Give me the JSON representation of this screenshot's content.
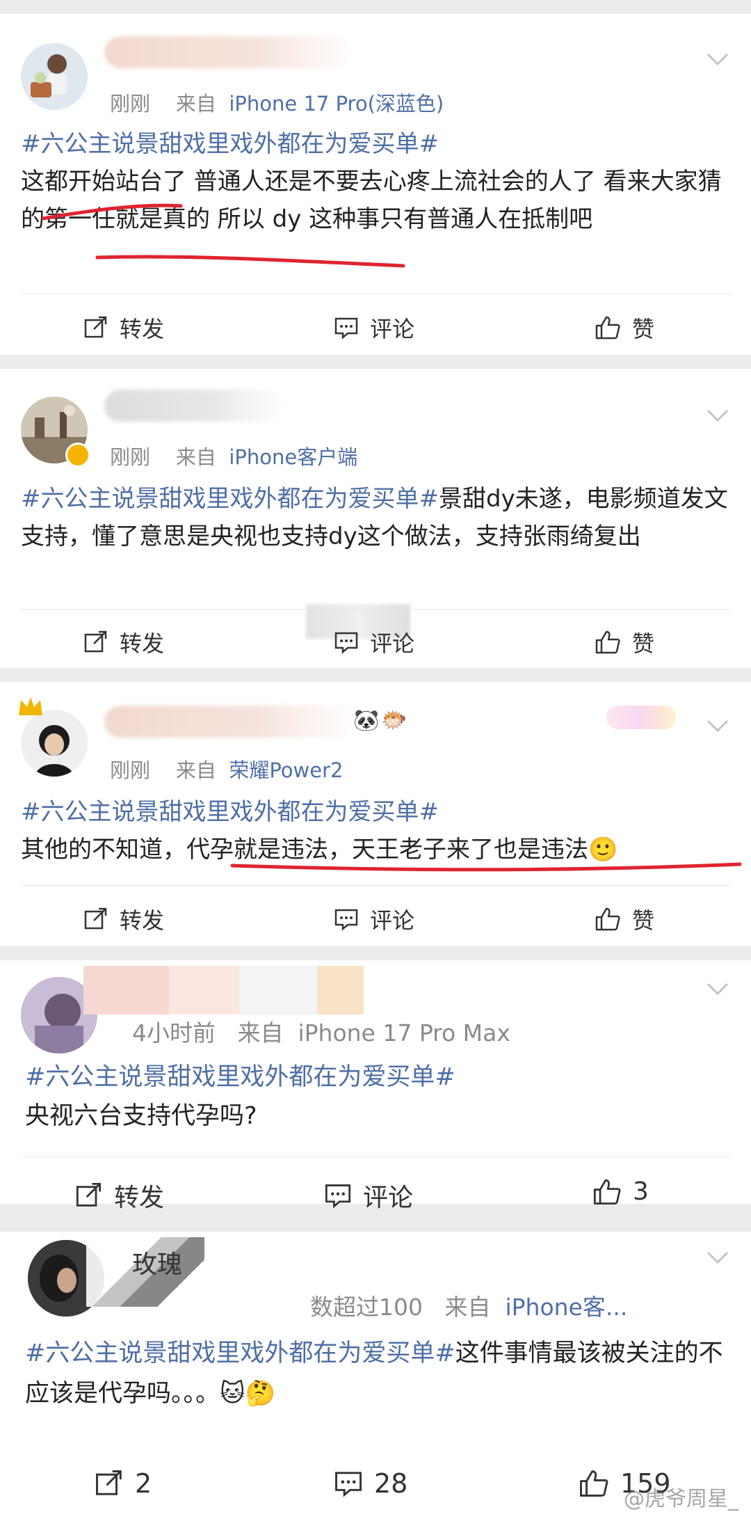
{
  "posts": [
    {
      "time": "刚刚",
      "from_prefix": "来自",
      "source": "iPhone 17 Pro(深蓝色)",
      "hashtag": "#六公主说景甜戏里戏外都在为爱买单#",
      "body": "这都开始站台了 普通人还是不要去心疼上流社会的人了 看来大家猜的第一任就是真的 所以 dy 这种事只有普通人在抵制吧",
      "actions": {
        "repost": "转发",
        "comment": "评论",
        "like": "赞"
      }
    },
    {
      "time": "刚刚",
      "from_prefix": "来自",
      "source": "iPhone客户端",
      "hashtag": "#六公主说景甜戏里戏外都在为爱买单#",
      "body": "景甜dy未遂，电影频道发文支持，懂了意思是央视也支持dy这个做法，支持张雨绮复出",
      "actions": {
        "repost": "转发",
        "comment": "评论",
        "like": "赞"
      }
    },
    {
      "time": "刚刚",
      "from_prefix": "来自",
      "source": "荣耀Power2",
      "hashtag": "#六公主说景甜戏里戏外都在为爱买单#",
      "body": "其他的不知道，代孕就是违法，天王老子来了也是违法",
      "emoji": "🙂",
      "actions": {
        "repost": "转发",
        "comment": "评论",
        "like": "赞"
      }
    },
    {
      "time": "4小时前",
      "from_prefix": "来自",
      "source": "iPhone 17 Pro Max",
      "hashtag": "#六公主说景甜戏里戏外都在为爱买单#",
      "body": "央视六台支持代孕吗?",
      "actions": {
        "repost": "转发",
        "comment": "评论",
        "like": "3"
      }
    },
    {
      "name_fragment": "玫瑰",
      "time": "数超过100",
      "from_prefix": "来自",
      "source": "iPhone客...",
      "hashtag": "#六公主说景甜戏里戏外都在为爱买单#",
      "body": "这件事情最该被关注的不应该是代孕吗。。。",
      "emoji": "🐱🤔",
      "actions": {
        "repost": "2",
        "comment": "28",
        "like": "159"
      }
    }
  ],
  "watermark": "@虎爷周星_",
  "colors": {
    "link": "#4e6fa5",
    "annotation": "#e0242f",
    "meta": "#8a8a8a"
  },
  "icons": [
    "repost-icon",
    "comment-icon",
    "like-icon",
    "chevron-down-icon",
    "verified-badge-icon"
  ]
}
